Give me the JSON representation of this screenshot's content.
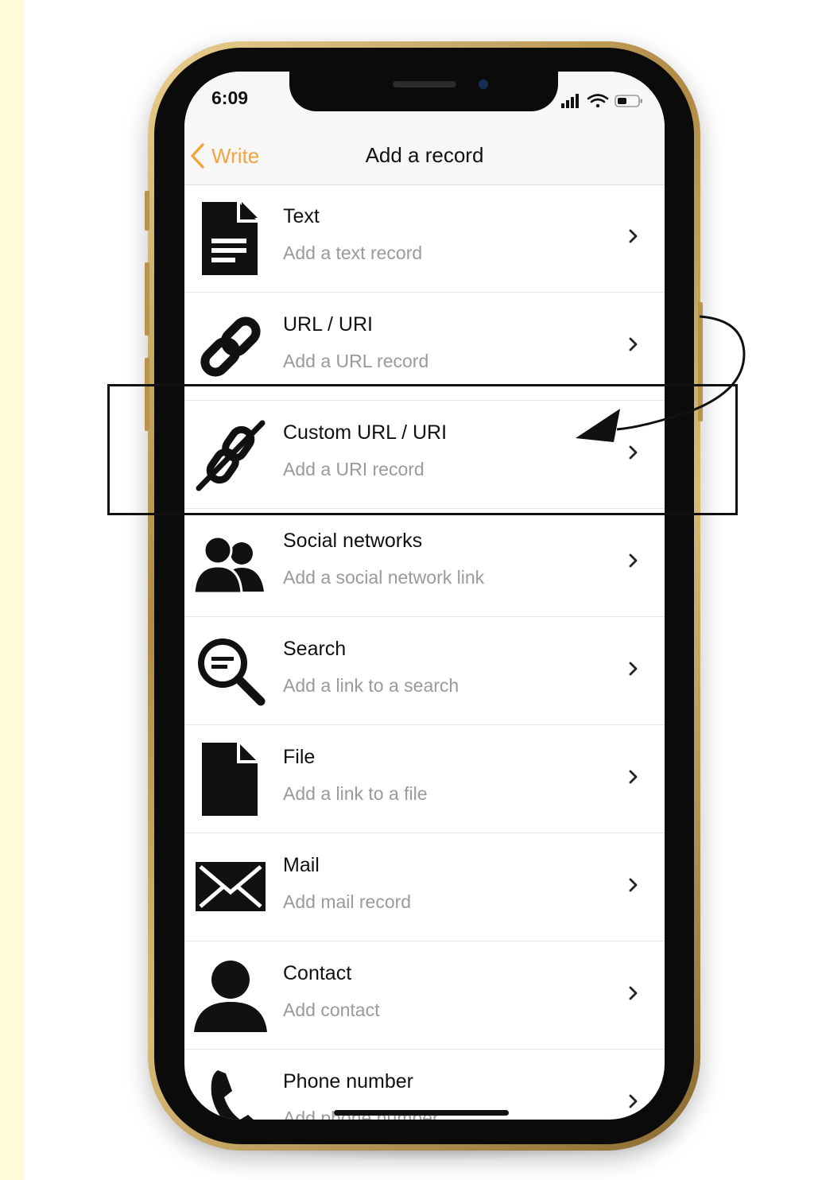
{
  "status_bar": {
    "time": "6:09",
    "icons": [
      "cellular-signal-icon",
      "wifi-icon",
      "battery-icon"
    ]
  },
  "nav": {
    "back_label": "Write",
    "title": "Add a record"
  },
  "colors": {
    "accent": "#f3a340",
    "background": "#fffbd7",
    "phone_frame": "#c9a75f"
  },
  "records": [
    {
      "id": "text",
      "icon": "document-text-icon",
      "title": "Text",
      "subtitle": "Add a text record"
    },
    {
      "id": "url",
      "icon": "link-icon",
      "title": "URL / URI",
      "subtitle": "Add a URL record"
    },
    {
      "id": "custom-url",
      "icon": "broken-link-icon",
      "title": "Custom URL / URI",
      "subtitle": "Add a URI record"
    },
    {
      "id": "social",
      "icon": "people-icon",
      "title": "Social networks",
      "subtitle": "Add a social network link"
    },
    {
      "id": "search",
      "icon": "search-icon",
      "title": "Search",
      "subtitle": "Add a link to a search"
    },
    {
      "id": "file",
      "icon": "file-icon",
      "title": "File",
      "subtitle": "Add a link to a file"
    },
    {
      "id": "mail",
      "icon": "mail-icon",
      "title": "Mail",
      "subtitle": "Add mail record"
    },
    {
      "id": "contact",
      "icon": "contact-icon",
      "title": "Contact",
      "subtitle": "Add contact"
    },
    {
      "id": "phone",
      "icon": "phone-icon",
      "title": "Phone number",
      "subtitle": "Add phone number"
    }
  ]
}
